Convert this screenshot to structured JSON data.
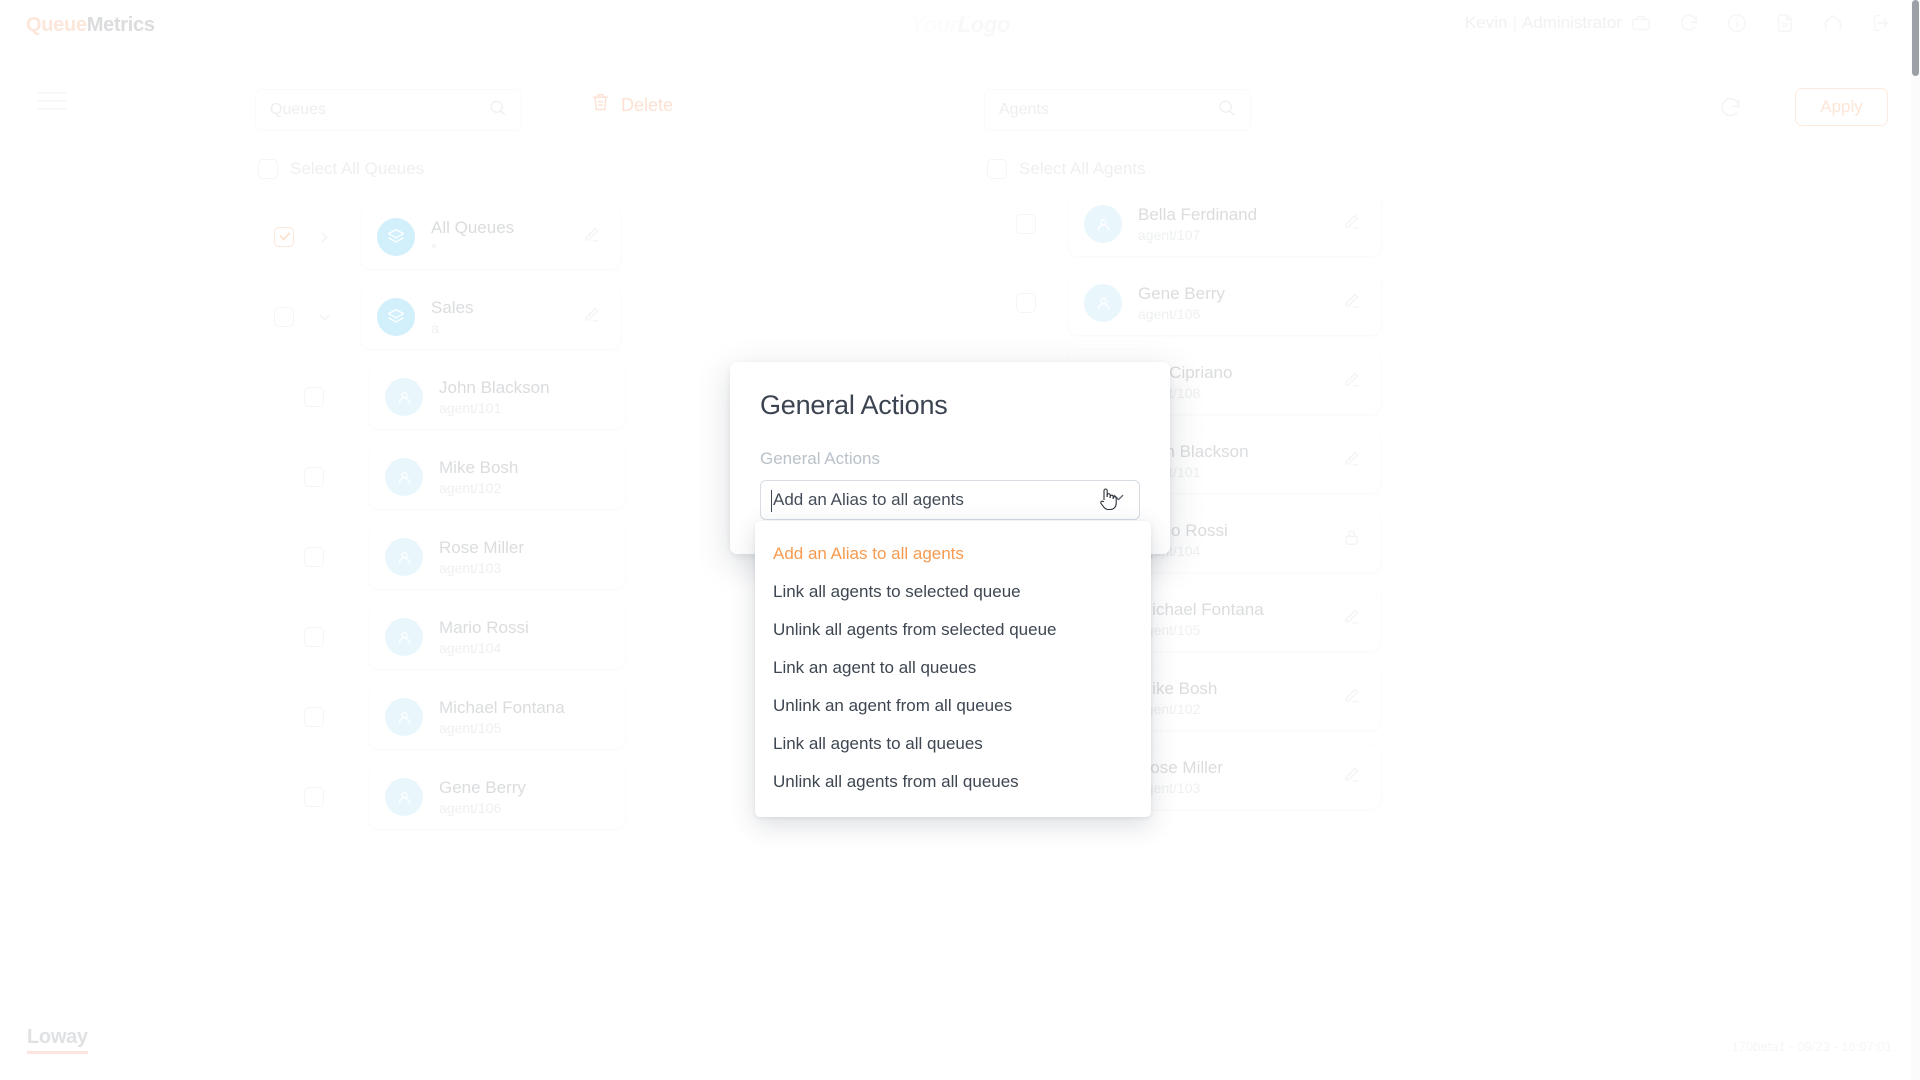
{
  "header": {
    "brand_first": "Queue",
    "brand_second": "Metrics",
    "logo_first": "Your",
    "logo_second": "Logo",
    "user_name": "Kevin",
    "user_separator": "|",
    "user_role": "Administrator",
    "icons": [
      "briefcase-icon",
      "refresh-icon",
      "info-icon",
      "document-icon",
      "home-icon",
      "logout-icon"
    ],
    "colors": {
      "brand_accent": "#f9b08a",
      "brand_text": "#8d9196"
    }
  },
  "toolbar": {
    "queue_search_placeholder": "Queues",
    "queue_search_value": "",
    "agent_search_placeholder": "Agents",
    "agent_search_value": "",
    "delete_label": "Delete",
    "apply_label": "Apply",
    "accent_color": "#f7a072"
  },
  "queues_panel": {
    "select_all_label": "Select All Queues",
    "select_all_checked": false,
    "rows": [
      {
        "name": "All Queues",
        "sub": "*",
        "checked": true,
        "expanded": false,
        "action": "edit-icon"
      },
      {
        "name": "Sales",
        "sub": "a",
        "checked": false,
        "expanded": true,
        "action": "edit-icon"
      }
    ],
    "agents": [
      {
        "name": "John Blackson",
        "sub": "agent/101",
        "checked": false
      },
      {
        "name": "Mike Bosh",
        "sub": "agent/102",
        "checked": false
      },
      {
        "name": "Rose Miller",
        "sub": "agent/103",
        "checked": false
      },
      {
        "name": "Mario Rossi",
        "sub": "agent/104",
        "checked": false
      },
      {
        "name": "Michael Fontana",
        "sub": "agent/105",
        "checked": false
      },
      {
        "name": "Gene Berry",
        "sub": "agent/106",
        "checked": false
      }
    ]
  },
  "agents_panel": {
    "select_all_label": "Select All Agents",
    "select_all_checked": false,
    "rows": [
      {
        "name": "Bella Ferdinand",
        "sub": "agent/107",
        "checked": false,
        "action": "edit-icon"
      },
      {
        "name": "Gene Berry",
        "sub": "agent/106",
        "checked": false,
        "action": "edit-icon"
      },
      {
        "name": "Jim Cipriano",
        "sub": "agent/108",
        "checked": false,
        "action": "edit-icon"
      },
      {
        "name": "John Blackson",
        "sub": "agent/101",
        "checked": false,
        "action": "edit-icon"
      },
      {
        "name": "Mario Rossi",
        "sub": "agent/104",
        "checked": false,
        "action": "lock-icon"
      },
      {
        "name": "Michael Fontana",
        "sub": "agent/105",
        "checked": false,
        "action": "edit-icon"
      },
      {
        "name": "Mike Bosh",
        "sub": "agent/102",
        "checked": false,
        "action": "edit-icon"
      },
      {
        "name": "Rose Miller",
        "sub": "agent/103",
        "checked": false,
        "action": "edit-icon"
      }
    ]
  },
  "modal": {
    "title": "General Actions",
    "field_label": "General Actions",
    "selected_value": "Add an Alias to all agents",
    "options": [
      "Add an Alias to all agents",
      "Link all agents to selected queue",
      "Unlink all agents from selected queue",
      "Link an agent to all queues",
      "Unlink an agent from all queues",
      "Link all agents to all queues",
      "Unlink all agents from all queues"
    ],
    "selected_index": 0,
    "highlight_color": "#f79a4f"
  },
  "footer": {
    "company": "Loway",
    "version": "170beta1 - 09/23 - 16:07:01"
  }
}
